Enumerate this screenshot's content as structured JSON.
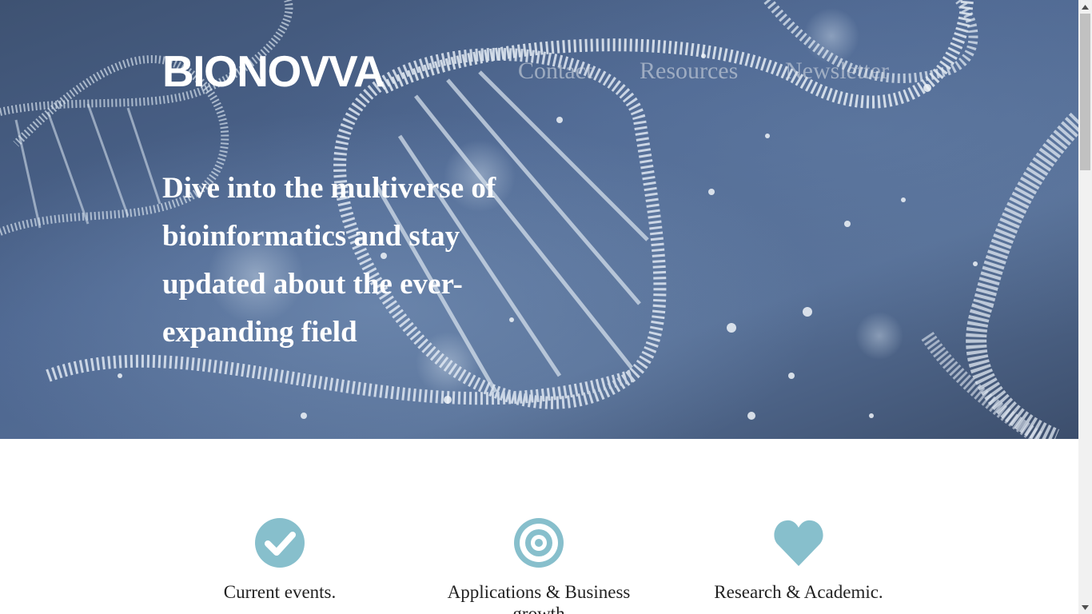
{
  "brand": {
    "logo": "BIONOVVA"
  },
  "nav": {
    "items": [
      {
        "label": "Contact"
      },
      {
        "label": "Resources"
      },
      {
        "label": "Newsletter"
      }
    ]
  },
  "hero": {
    "tagline": "Dive into the multiverse of bioinformatics and stay updated about the ever-expanding field"
  },
  "features": [
    {
      "label": "Current events.",
      "icon": "check-circle-icon"
    },
    {
      "label": "Applications & Business growth",
      "icon": "target-icon"
    },
    {
      "label": "Research & Academic.",
      "icon": "heart-icon"
    }
  ],
  "colors": {
    "accent": "#87bfcc",
    "hero_bg": "#4d6690",
    "text": "#222222"
  }
}
